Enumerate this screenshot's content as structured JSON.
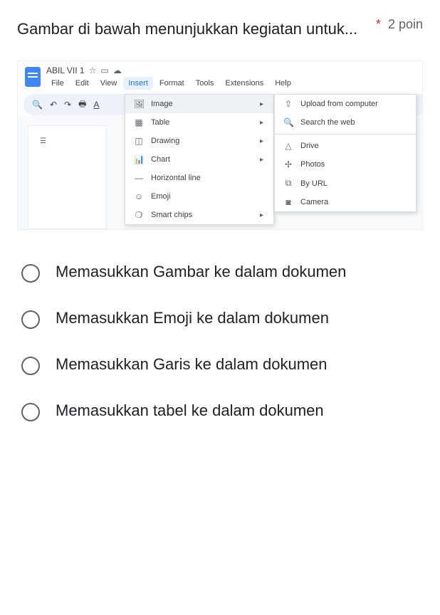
{
  "question": {
    "text": "Gambar di bawah menunjukkan kegiatan untuk...",
    "required_mark": "*",
    "points_label": "2 poin"
  },
  "screenshot": {
    "doc_title": "ABIL VII 1",
    "menubar": [
      "File",
      "Edit",
      "View",
      "Insert",
      "Format",
      "Tools",
      "Extensions",
      "Help"
    ],
    "active_menu_index": 3,
    "insert_menu": [
      {
        "icon": "🖼",
        "label": "Image",
        "arrow": true,
        "hl": true
      },
      {
        "icon": "▦",
        "label": "Table",
        "arrow": true
      },
      {
        "icon": "◫",
        "label": "Drawing",
        "arrow": true
      },
      {
        "icon": "⫿",
        "label": "Chart",
        "arrow": true
      },
      {
        "icon": "—",
        "label": "Horizontal line",
        "arrow": false
      },
      {
        "icon": "☺",
        "label": "Emoji",
        "arrow": false
      },
      {
        "icon": "❍",
        "label": "Smart chips",
        "arrow": true
      }
    ],
    "image_submenu": [
      {
        "icon": "⤒",
        "label": "Upload from computer"
      },
      {
        "icon": "⌕",
        "label": "Search the web"
      },
      {
        "sep": true
      },
      {
        "icon": "△",
        "label": "Drive"
      },
      {
        "icon": "✢",
        "label": "Photos"
      },
      {
        "icon": "⊂⊃",
        "label": "By URL"
      },
      {
        "icon": "◙",
        "label": "Camera"
      }
    ]
  },
  "options": [
    "Memasukkan Gambar ke dalam dokumen",
    "Memasukkan Emoji ke dalam dokumen",
    "Memasukkan Garis ke dalam dokumen",
    "Memasukkan tabel ke dalam dokumen"
  ]
}
